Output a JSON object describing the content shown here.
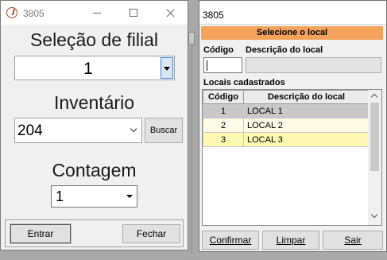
{
  "left_window": {
    "title": "3805",
    "filial_label": "Seleção de filial",
    "filial_value": "1",
    "inventario_label": "Inventário",
    "inventario_value": "204",
    "buscar_label": "Buscar",
    "contagem_label": "Contagem",
    "contagem_value": "1",
    "entrar_label": "Entrar",
    "fechar_label": "Fechar"
  },
  "right_window": {
    "title": "3805",
    "header": "Selecione o local",
    "codigo_label": "Código",
    "descricao_label": "Descrição do local",
    "codigo_value": "",
    "descricao_value": "",
    "locais_label": "Locais cadastrados",
    "grid": {
      "columns": [
        "Código",
        "Descrição do local"
      ],
      "rows": [
        {
          "codigo": "1",
          "descricao": "LOCAL 1"
        },
        {
          "codigo": "2",
          "descricao": "LOCAL 2"
        },
        {
          "codigo": "3",
          "descricao": "LOCAL 3"
        }
      ],
      "row_colors": [
        "#c8c8c8",
        "#fdfae6",
        "#fff8b3"
      ]
    },
    "confirmar_label": "Confirmar",
    "limpar_label": "Limpar",
    "sair_label": "Sair"
  },
  "colors": {
    "header_band": "#f5a35a",
    "selected_row": "#fff8b3",
    "dropdown_accent": "#3f7fd4"
  }
}
